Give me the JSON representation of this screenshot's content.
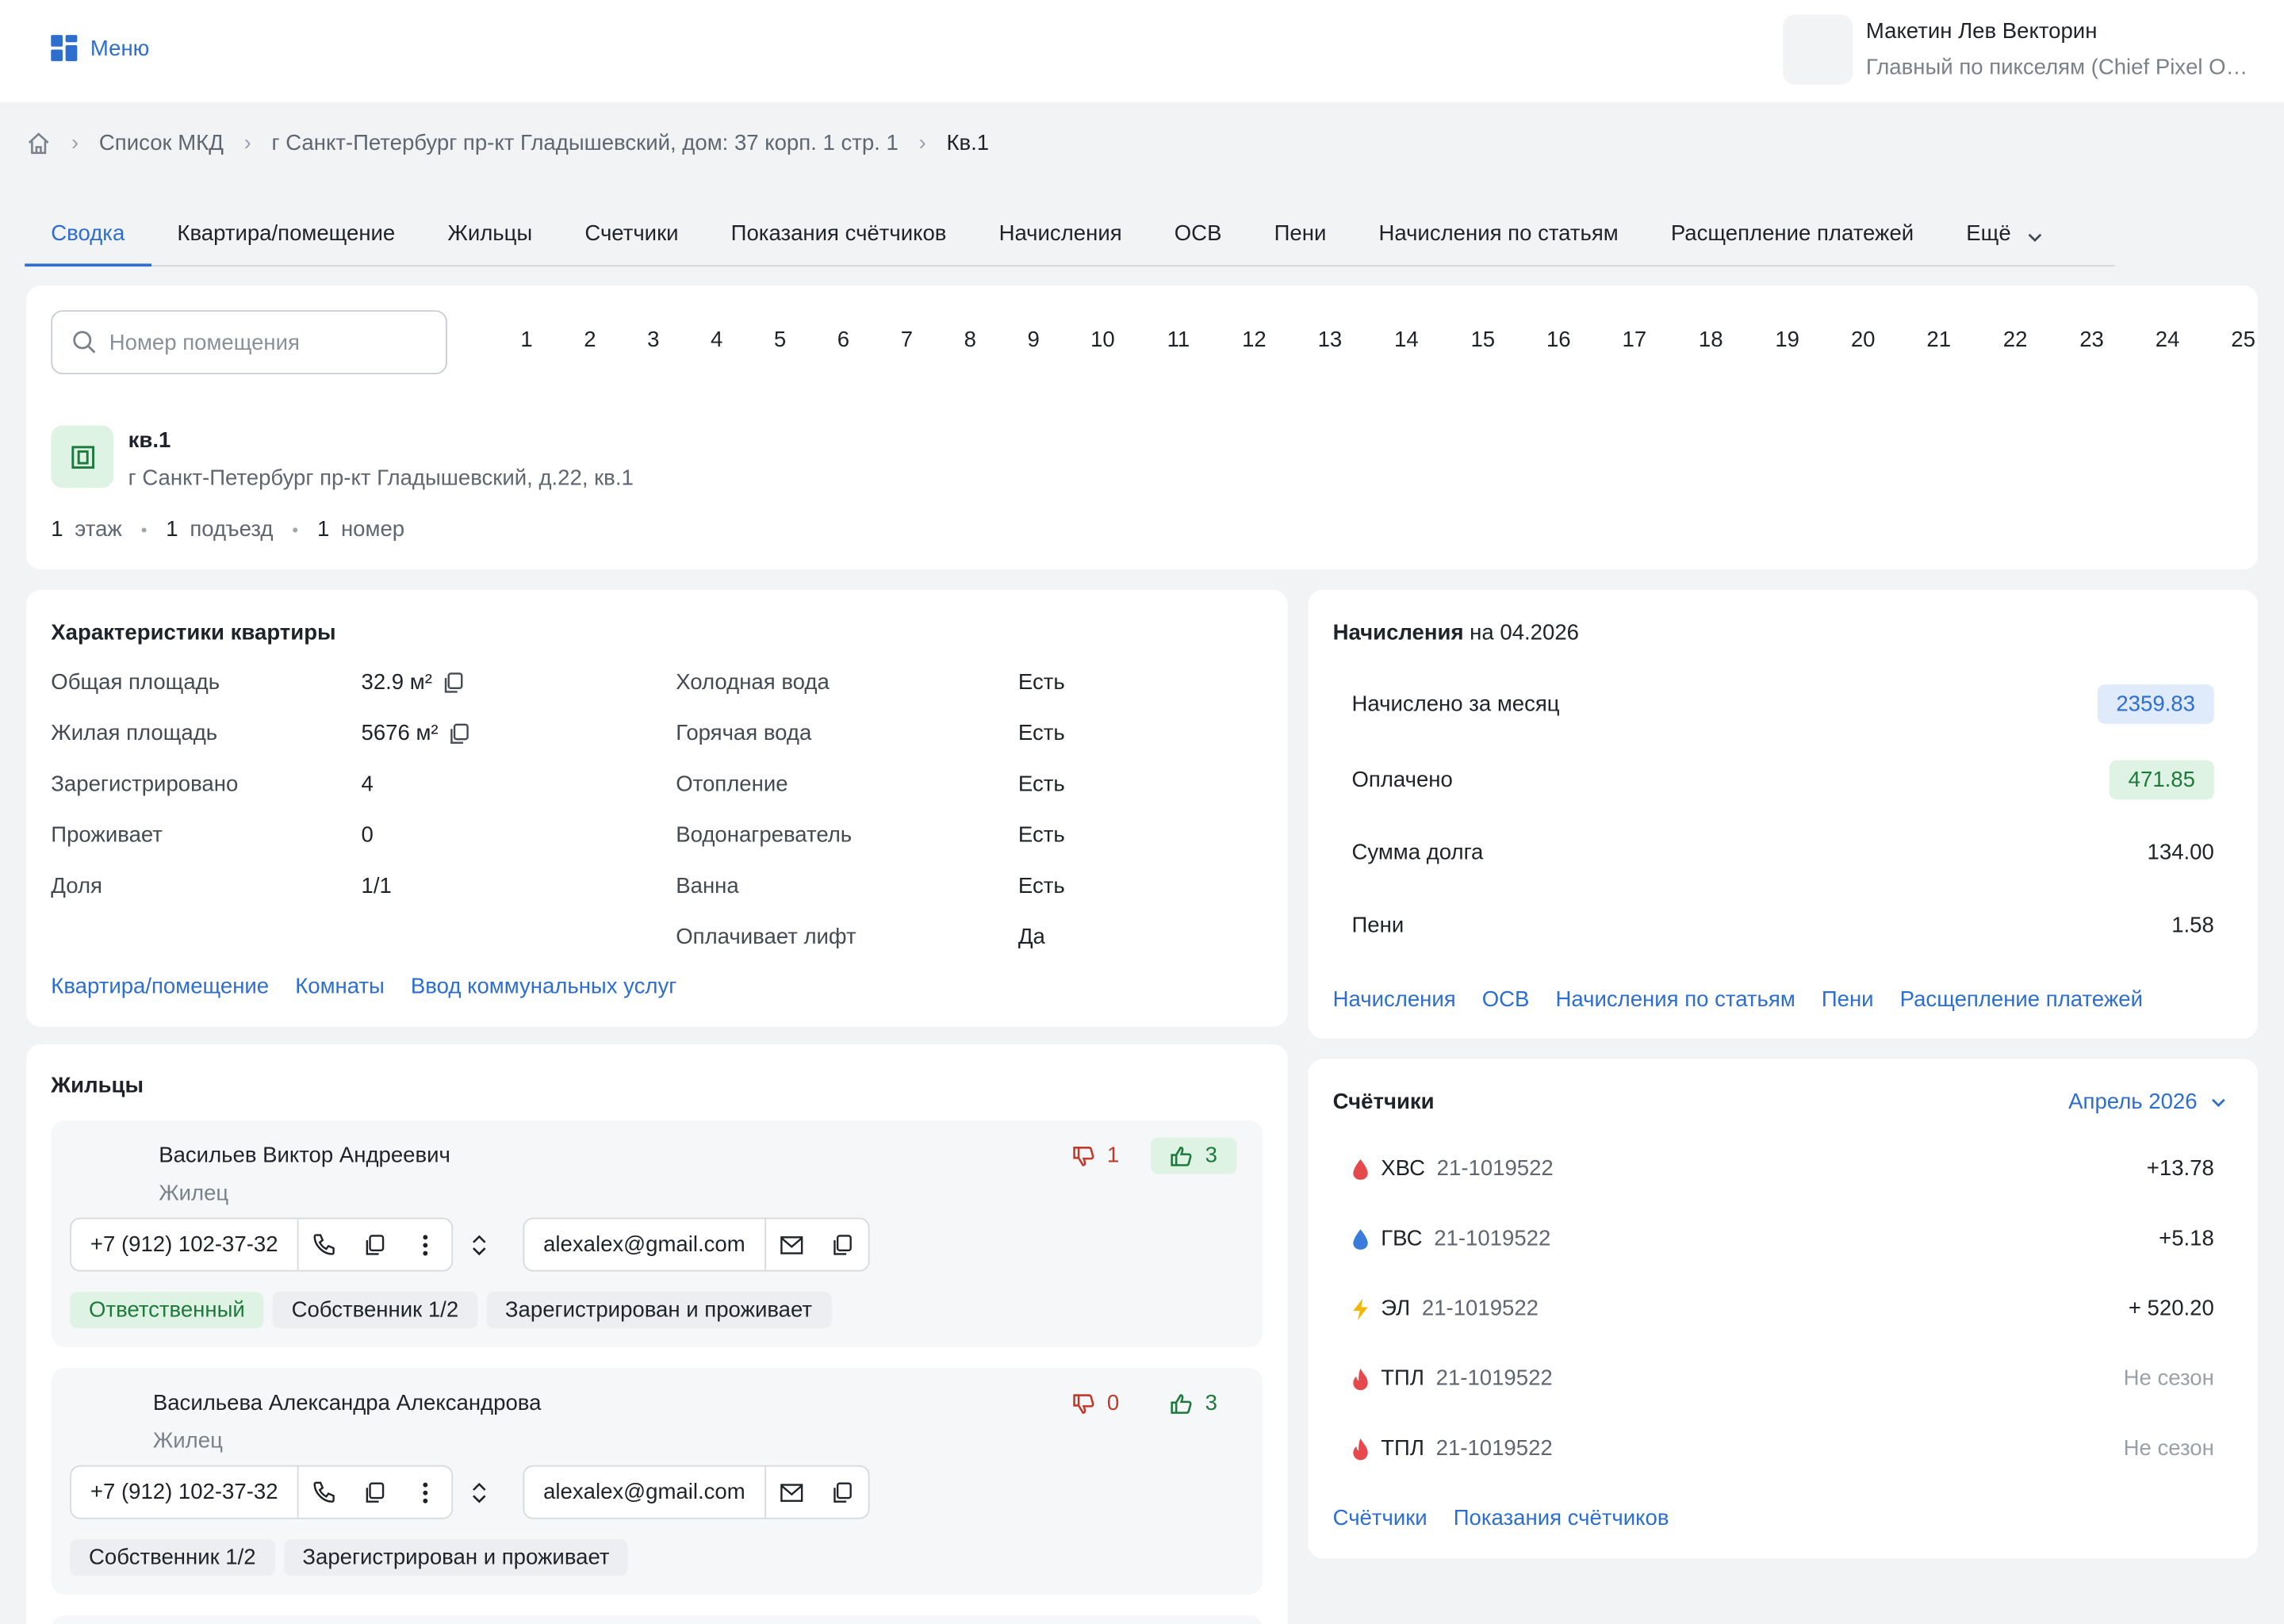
{
  "header": {
    "menu_label": "Меню",
    "user_name": "Макетин Лев Векторин",
    "user_role": "Главный по пикселям (Chief Pixel Officer)"
  },
  "breadcrumbs": [
    "Список МКД",
    "г Санкт-Петербург пр-кт Гладышевский, дом: 37 корп. 1 стр. 1",
    "Кв.1"
  ],
  "tabs": [
    "Сводка",
    "Квартира/помещение",
    "Жильцы",
    "Счетчики",
    "Показания счётчиков",
    "Начисления",
    "ОСВ",
    "Пени",
    "Начисления по статьям",
    "Расщепление платежей",
    "Ещё"
  ],
  "search": {
    "placeholder": "Номер помещения",
    "value": ""
  },
  "pages": [
    "1",
    "2",
    "3",
    "4",
    "5",
    "6",
    "7",
    "8",
    "9",
    "10",
    "11",
    "12",
    "13",
    "14",
    "15",
    "16",
    "17",
    "18",
    "19",
    "20",
    "21",
    "22",
    "23",
    "24",
    "25"
  ],
  "apartment": {
    "title": "кв.1",
    "address": "г Санкт-Петербург пр-кт Гладышевский, д.22, кв.1",
    "floor_num": "1",
    "floor_label": "этаж",
    "entrance_num": "1",
    "entrance_label": "подъезд",
    "number_num": "1",
    "number_label": "номер"
  },
  "characteristics": {
    "title": "Характеристики квартиры",
    "left": [
      {
        "label": "Общая площадь",
        "value": "32.9 м²"
      },
      {
        "label": "Жилая площадь",
        "value": "5676 м²"
      },
      {
        "label": "Зарегистрировано",
        "value": "4"
      },
      {
        "label": "Проживает",
        "value": "0"
      },
      {
        "label": "Доля",
        "value": "1/1"
      }
    ],
    "right": [
      {
        "label": "Холодная вода",
        "value": "Есть"
      },
      {
        "label": "Горячая вода",
        "value": "Есть"
      },
      {
        "label": "Отопление",
        "value": "Есть"
      },
      {
        "label": "Водонагреватель",
        "value": "Есть"
      },
      {
        "label": "Ванна",
        "value": "Есть"
      },
      {
        "label": "Оплачивает лифт",
        "value": "Да"
      }
    ],
    "links": [
      "Квартира/помещение",
      "Комнаты",
      "Ввод коммунальных услуг"
    ]
  },
  "charges": {
    "title": "Начисления",
    "date": "на 04.2026",
    "rows": [
      {
        "label": "Начислено за месяц",
        "value": "2359.83"
      },
      {
        "label": "Оплачено",
        "value": "471.85"
      },
      {
        "label": "Сумма долга",
        "value": "134.00"
      },
      {
        "label": "Пени",
        "value": "1.58"
      }
    ],
    "links": [
      "Начисления",
      "ОСВ",
      "Начисления по статьям",
      "Пени",
      "Расщепление платежей"
    ]
  },
  "residents": {
    "title": "Жильцы",
    "items": [
      {
        "name": "Васильев Виктор Андреевич",
        "role": "Жилец",
        "down": "1",
        "up": "3",
        "phone": "+7 (912) 102-37-32",
        "email": "alexalex@gmail.com",
        "tags": [
          "Ответственный",
          "Собственник 1/2",
          "Зарегистрирован и проживает"
        ]
      },
      {
        "name": "Васильева Александра Александрова",
        "role": "Жилец",
        "down": "0",
        "up": "3",
        "phone": "+7 (912) 102-37-32",
        "email": "alexalex@gmail.com",
        "tags": [
          "Собственник 1/2",
          "Зарегистрирован и проживает"
        ]
      }
    ]
  },
  "meters": {
    "title": "Счётчики",
    "period": "Апрель 2026",
    "items": [
      {
        "type": "ХВС",
        "number": "21-1019522",
        "value": "+13.78",
        "icon": "drop-red-icon"
      },
      {
        "type": "ГВС",
        "number": "21-1019522",
        "value": "+5.18",
        "icon": "drop-blue-icon"
      },
      {
        "type": "ЭЛ",
        "number": "21-1019522",
        "value": "+ 520.20",
        "icon": "lightning-icon"
      },
      {
        "type": "ТПЛ",
        "number": "21-1019522",
        "value": "Не сезон",
        "icon": "flame-icon"
      },
      {
        "type": "ТПЛ",
        "number": "21-1019522",
        "value": "Не сезон",
        "icon": "flame-icon"
      }
    ],
    "links": [
      "Счётчики",
      "Показания счётчиков"
    ]
  },
  "colors": {
    "accent": "#2d6ecf",
    "green_bg": "#dff3e4",
    "blue_bg": "#dfeafb",
    "red": "#c0392b"
  }
}
